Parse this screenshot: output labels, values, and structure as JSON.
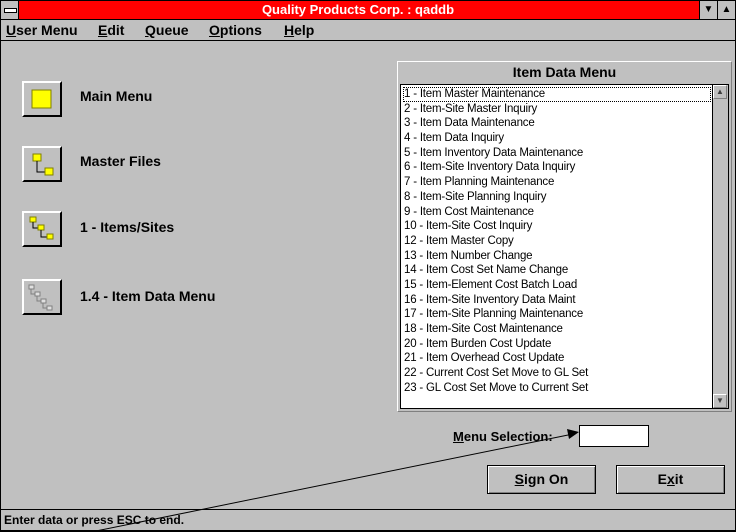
{
  "window": {
    "title": "Quality Products Corp. : qaddb",
    "system_menu_icon": "system-menu-icon",
    "scroll_down_icon": "▼",
    "scroll_up_icon": "▲"
  },
  "menubar": {
    "user_menu": {
      "hotkey": "U",
      "rest": "ser Menu"
    },
    "edit": {
      "hotkey": "E",
      "rest": "dit"
    },
    "queue": {
      "hotkey": "Q",
      "rest": "ueue"
    },
    "options": {
      "hotkey": "O",
      "rest": "ptions"
    },
    "help": {
      "hotkey": "H",
      "rest": "elp"
    }
  },
  "nav": {
    "main_menu": "Main Menu",
    "master_files": "Master Files",
    "items_sites": "1 - Items/Sites",
    "item_data_menu": "1.4 - Item Data Menu"
  },
  "list": {
    "header": "Item Data Menu",
    "items": [
      "1 - Item Master Maintenance",
      "2 - Item-Site Master Inquiry",
      "3 - Item Data Maintenance",
      "4 - Item Data Inquiry",
      "5 - Item Inventory Data Maintenance",
      "6 - Item-Site Inventory Data Inquiry",
      "7 - Item Planning Maintenance",
      "8 - Item-Site Planning Inquiry",
      "9 - Item Cost Maintenance",
      "10 - Item-Site Cost Inquiry",
      "12 - Item Master Copy",
      "13 - Item Number Change",
      "14 - Item Cost Set Name Change",
      "15 - Item-Element Cost Batch Load",
      "16 - Item-Site Inventory Data Maint",
      "17 - Item-Site Planning Maintenance",
      "18 - Item-Site Cost Maintenance",
      "20 - Item Burden Cost Update",
      "21 - Item Overhead Cost Update",
      "22 - Current Cost Set Move to GL Set",
      "23 - GL Cost Set Move to Current Set"
    ],
    "scroll_up_icon": "▲",
    "scroll_down_icon": "▼"
  },
  "menu_selection": {
    "hotkey": "M",
    "rest": "enu Selection:",
    "value": ""
  },
  "buttons": {
    "sign_on": {
      "hotkey": "S",
      "rest": "ign On"
    },
    "exit": {
      "pre": "E",
      "hotkey": "x",
      "rest": "it"
    }
  },
  "status_text": "Enter data or press ESC to end.",
  "colors": {
    "titlebar": "#ff0000",
    "face": "#c0c0c0",
    "nav_icon_yellow": "#ffff00"
  }
}
